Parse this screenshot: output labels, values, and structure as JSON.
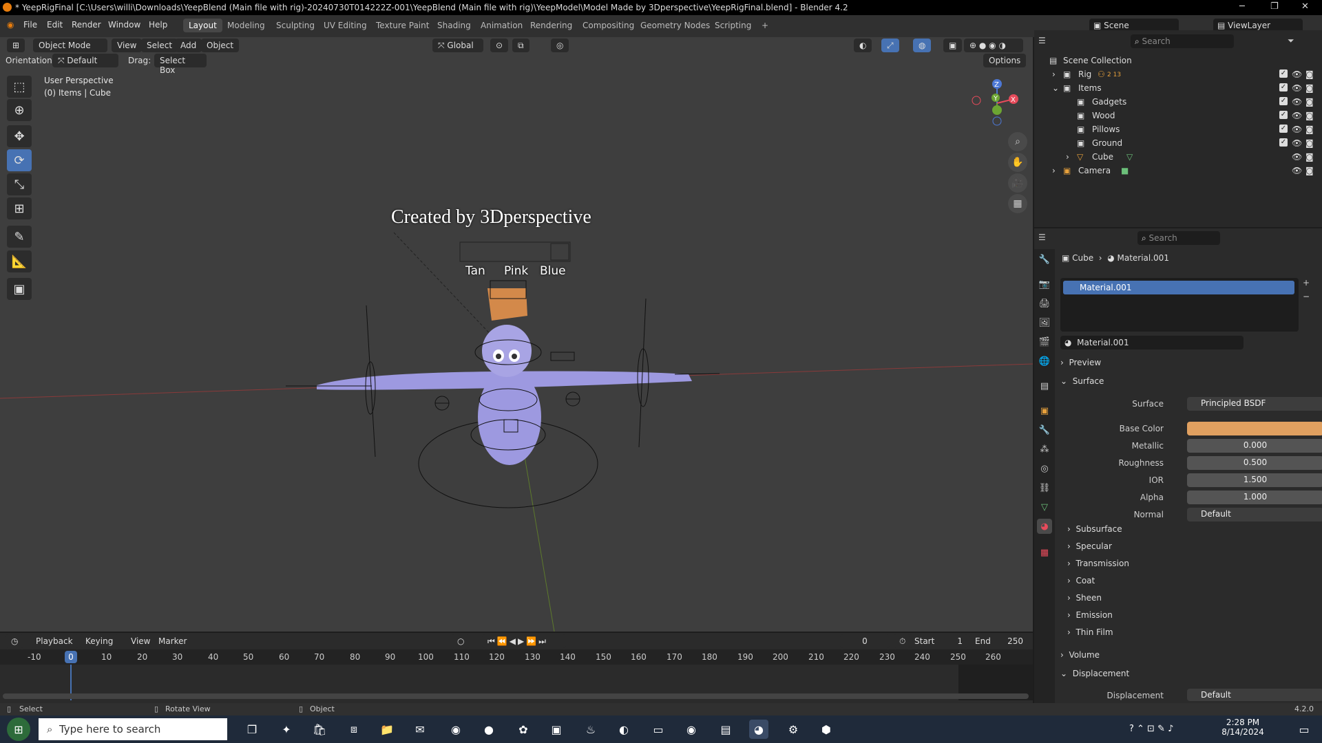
{
  "window": {
    "title": "* YeepRigFinal [C:\\Users\\willi\\Downloads\\YeepBlend (Main file with rig)-20240730T014222Z-001\\YeepBlend (Main file with rig)\\YeepModel\\Model Made by 3Dperspective\\YeepRigFinal.blend] - Blender 4.2"
  },
  "menu": [
    "File",
    "Edit",
    "Render",
    "Window",
    "Help"
  ],
  "workspaces": [
    "Layout",
    "Modeling",
    "Sculpting",
    "UV Editing",
    "Texture Paint",
    "Shading",
    "Animation",
    "Rendering",
    "Compositing",
    "Geometry Nodes",
    "Scripting"
  ],
  "active_workspace": "Layout",
  "scene": {
    "label": "Scene",
    "viewlayer": "ViewLayer"
  },
  "header": {
    "mode": "Object Mode",
    "view": "View",
    "select": "Select",
    "add": "Add",
    "object": "Object",
    "transform": "Global",
    "options": "Options",
    "orientation_label": "Orientation:",
    "orientation_value": "Default",
    "drag_label": "Drag:",
    "drag_value": "Select Box"
  },
  "viewport": {
    "perspective": "User Perspective",
    "info": "(0) Items | Cube",
    "watermark": "Created by 3Dperspective",
    "labels": [
      "Tan",
      "Pink",
      "Blue"
    ]
  },
  "outliner": {
    "search_placeholder": "Search",
    "items": [
      {
        "name": "Scene Collection",
        "indent": 0,
        "expand": ""
      },
      {
        "name": "Rig",
        "indent": 1,
        "expand": "›",
        "extra": "2 13"
      },
      {
        "name": "Items",
        "indent": 1,
        "expand": "⌄"
      },
      {
        "name": "Gadgets",
        "indent": 2,
        "expand": ""
      },
      {
        "name": "Wood",
        "indent": 2,
        "expand": ""
      },
      {
        "name": "Pillows",
        "indent": 2,
        "expand": ""
      },
      {
        "name": "Ground",
        "indent": 2,
        "expand": ""
      },
      {
        "name": "Cube",
        "indent": 2,
        "expand": "›"
      },
      {
        "name": "Camera",
        "indent": 1,
        "expand": "›"
      }
    ]
  },
  "properties": {
    "search_placeholder": "Search",
    "breadcrumb_object": "Cube",
    "breadcrumb_material": "Material.001",
    "slot": "Material.001",
    "material_name": "Material.001",
    "preview": "Preview",
    "surface_section": "Surface",
    "surface_label": "Surface",
    "surface_value": "Principled BSDF",
    "fields": [
      {
        "label": "Base Color",
        "value": "",
        "color": "#e0a060"
      },
      {
        "label": "Metallic",
        "value": "0.000"
      },
      {
        "label": "Roughness",
        "value": "0.500"
      },
      {
        "label": "IOR",
        "value": "1.500"
      },
      {
        "label": "Alpha",
        "value": "1.000"
      },
      {
        "label": "Normal",
        "value": "Default"
      }
    ],
    "subsections": [
      "Subsurface",
      "Specular",
      "Transmission",
      "Coat",
      "Sheen",
      "Emission",
      "Thin Film"
    ],
    "volume": "Volume",
    "displacement_section": "Displacement",
    "displacement_label": "Displacement",
    "displacement_value": "Default"
  },
  "timeline": {
    "playback": "Playback",
    "keying": "Keying",
    "view": "View",
    "marker": "Marker",
    "current_frame": "0",
    "start_label": "Start",
    "start": "1",
    "end_label": "End",
    "end": "250",
    "ticks": [
      "-10",
      "0",
      "10",
      "20",
      "30",
      "40",
      "50",
      "60",
      "70",
      "80",
      "90",
      "100",
      "110",
      "120",
      "130",
      "140",
      "150",
      "160",
      "170",
      "180",
      "190",
      "200",
      "210",
      "220",
      "230",
      "240",
      "250",
      "260"
    ]
  },
  "status": {
    "select": "Select",
    "rotate": "Rotate View",
    "object": "Object",
    "version": "4.2.0"
  },
  "taskbar": {
    "search_placeholder": "Type here to search",
    "time": "2:28 PM",
    "date": "8/14/2024"
  }
}
